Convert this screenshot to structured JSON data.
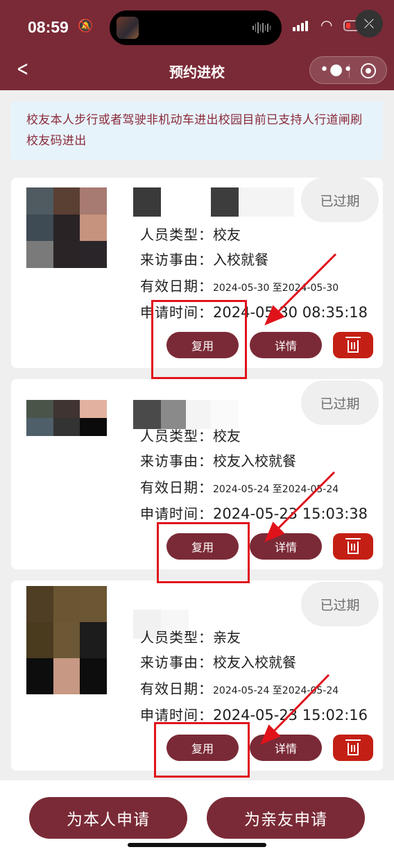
{
  "status_bar": {
    "time": "08:59",
    "mute_icon": "bell-slash-icon",
    "wifi_icon": "wifi-icon"
  },
  "header": {
    "title": "预约进校",
    "back_icon": "chevron-left-icon",
    "more_icon": "more-dots-icon",
    "close_icon": "target-icon"
  },
  "notice": {
    "text": "校友本人步行或者驾驶非机动车进出校园目前已支持人行道闸刷校友码进出"
  },
  "labels": {
    "type": "人员类型：",
    "reason": "来访事由：",
    "valid": "有效日期：",
    "applied": "申请时间：",
    "reuse": "复用",
    "detail": "详情",
    "delete_icon": "trash-icon"
  },
  "cards": [
    {
      "status": "已过期",
      "type": "校友",
      "reason": "入校就餐",
      "valid": "2024-05-30 至2024-05-30",
      "applied": "2024-05-30 08:35:18"
    },
    {
      "status": "已过期",
      "type": "校友",
      "reason": "校友入校就餐",
      "valid": "2024-05-24 至2024-05-24",
      "applied": "2024-05-23 15:03:38"
    },
    {
      "status": "已过期",
      "type": "亲友",
      "reason": "校友入校就餐",
      "valid": "2024-05-24 至2024-05-24",
      "applied": "2024-05-23 15:02:16"
    }
  ],
  "bottom": {
    "self_apply": "为本人申请",
    "relative_apply": "为亲友申请"
  },
  "colors": {
    "brand": "#7a2a36",
    "delete": "#c41f14",
    "highlight": "#e0131b"
  }
}
